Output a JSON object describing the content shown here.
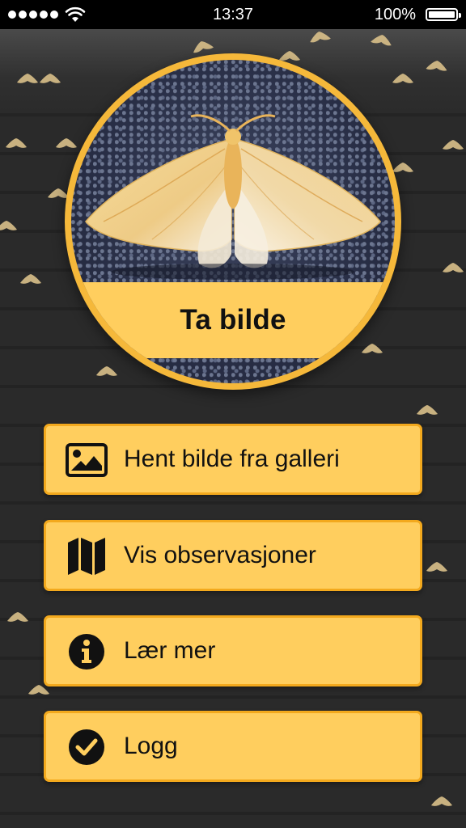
{
  "status_bar": {
    "time": "13:37",
    "battery_percent": "100%",
    "signal_dots": 5
  },
  "hero": {
    "label": "Ta bilde",
    "icon": "camera-photo"
  },
  "menu": {
    "items": [
      {
        "label": "Hent bilde fra galleri",
        "icon": "image-icon"
      },
      {
        "label": "Vis observasjoner",
        "icon": "map-icon"
      },
      {
        "label": "Lær mer",
        "icon": "info-icon"
      },
      {
        "label": "Logg",
        "icon": "check-circle-icon"
      }
    ]
  },
  "colors": {
    "background": "#262626",
    "accent": "#ffce5e",
    "accent_border": "#f3a91d",
    "moth_decoration": "#d9c08a"
  }
}
